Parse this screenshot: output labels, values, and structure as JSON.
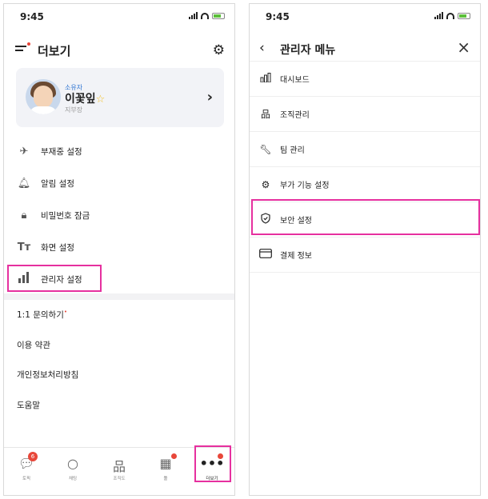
{
  "left": {
    "status": {
      "time": "9:45"
    },
    "header": {
      "title": "더보기"
    },
    "profile": {
      "role": "소유자",
      "name": "이꽃잎",
      "position": "지부장"
    },
    "menu": [
      {
        "icon": "airplane-icon",
        "label": "부재중 설정"
      },
      {
        "icon": "bell-icon",
        "label": "알림 설정"
      },
      {
        "icon": "lock-icon",
        "label": "비밀번호 잠금"
      },
      {
        "icon": "text-size-icon",
        "label": "화면 설정"
      },
      {
        "icon": "bar-chart-icon",
        "label": "관리자 설정"
      }
    ],
    "links": [
      {
        "label": "1:1 문의하기",
        "mark": "•"
      },
      {
        "label": "이용 약관",
        "mark": ""
      },
      {
        "label": "개인정보처리방침",
        "mark": ""
      },
      {
        "label": "도움말",
        "mark": ""
      }
    ],
    "tabs": [
      {
        "icon": "chat-icon",
        "label": "토픽",
        "badge": "6"
      },
      {
        "icon": "search-icon",
        "label": "채팅",
        "badge": ""
      },
      {
        "icon": "org-chart-icon",
        "label": "조직도",
        "badge": ""
      },
      {
        "icon": "grid-icon",
        "label": "툴",
        "badge": "dot"
      },
      {
        "icon": "more-icon",
        "label": "더보기",
        "badge": "dot"
      }
    ]
  },
  "right": {
    "status": {
      "time": "9:45"
    },
    "header": {
      "title": "관리자 메뉴"
    },
    "menu": [
      {
        "icon": "dashboard-icon",
        "label": "대시보드"
      },
      {
        "icon": "org-icon",
        "label": "조직관리"
      },
      {
        "icon": "wrench-icon",
        "label": "팀 관리"
      },
      {
        "icon": "settings-icon",
        "label": "부가 기능 설정"
      },
      {
        "icon": "shield-icon",
        "label": "보안 설정"
      },
      {
        "icon": "card-icon",
        "label": "결제 정보"
      }
    ]
  },
  "colors": {
    "highlight": "#e6309f",
    "badge": "#e8473a",
    "accent": "#2c73d2"
  }
}
